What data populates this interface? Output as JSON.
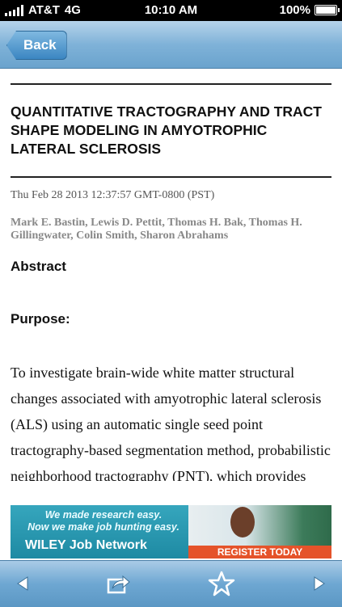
{
  "status": {
    "carrier": "AT&T",
    "network": "4G",
    "time": "10:10 AM",
    "battery": "100%",
    "battery_level": 1.0
  },
  "nav": {
    "back_label": "Back"
  },
  "article": {
    "title": "QUANTITATIVE TRACTOGRAPHY AND TRACT SHAPE MODELING IN AMYOTROPHIC LATERAL SCLEROSIS",
    "date": "Thu Feb 28 2013 12:37:57 GMT-0800 (PST)",
    "authors": "Mark E. Bastin, Lewis D. Pettit, Thomas H. Bak, Thomas H. Gillingwater, Colin Smith, Sharon Abrahams",
    "abstract_heading": "Abstract",
    "purpose_heading": "Purpose:",
    "purpose_text": "To investigate brain-wide white matter structural changes associated with amyotrophic lateral sclerosis (ALS) using an automatic single seed point tractography-based segmentation method, probabilistic neighborhood tractography (PNT), which provides quantitative"
  },
  "ad": {
    "line1": "We made research easy.",
    "line2": "Now we make job hunting easy.",
    "brand": "WILEY Job Network",
    "cta": "REGISTER TODAY"
  },
  "toolbar": {
    "icons": [
      "back-arrow-icon",
      "share-icon",
      "star-icon",
      "forward-arrow-icon"
    ]
  }
}
